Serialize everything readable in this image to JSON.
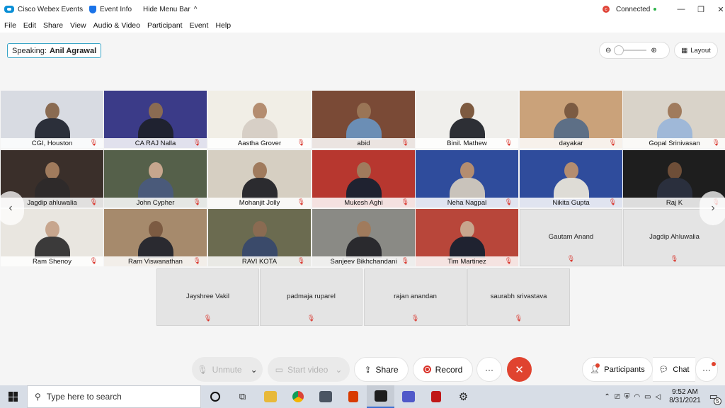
{
  "titlebar": {
    "app_name": "Cisco Webex Events",
    "event_info": "Event Info",
    "hide_menu": "Hide Menu Bar",
    "status": "Connected"
  },
  "menu": [
    "File",
    "Edit",
    "Share",
    "View",
    "Audio & Video",
    "Participant",
    "Event",
    "Help"
  ],
  "speaking": {
    "label": "Speaking:",
    "name": "Anil Agrawal"
  },
  "layout_label": "Layout",
  "participants": [
    {
      "name": "CGI, Houston",
      "bg": "#d8dbe2",
      "skin": "#8a6b52",
      "shirt": "#2b2f3a"
    },
    {
      "name": "CA RAJ Nalla",
      "bg": "#3b3b88",
      "skin": "#8a6b52",
      "shirt": "#1f2230"
    },
    {
      "name": "Aastha Grover",
      "bg": "#f1eee6",
      "skin": "#b48d70",
      "shirt": "#d7cfc6"
    },
    {
      "name": "abid",
      "bg": "#7a4a36",
      "skin": "#9a7556",
      "shirt": "#6b8eb5"
    },
    {
      "name": "Binil. Mathew",
      "bg": "#f0efec",
      "skin": "#7d5a40",
      "shirt": "#2d2f35"
    },
    {
      "name": "dayakar",
      "bg": "#caa27a",
      "skin": "#7c5b42",
      "shirt": "#5d6f86"
    },
    {
      "name": "Gopal Srinivasan",
      "bg": "#d9d3c9",
      "skin": "#a07b5d",
      "shirt": "#9fb8d8"
    },
    {
      "name": "Jagdip ahluwalia",
      "bg": "#3a2f2a",
      "skin": "#a07b5d",
      "shirt": "#2e2a2a"
    },
    {
      "name": "John Cypher",
      "bg": "#55604a",
      "skin": "#c7a68e",
      "shirt": "#4a5a7a"
    },
    {
      "name": "Mohanjit Jolly",
      "bg": "#d6cfc2",
      "skin": "#a07b5d",
      "shirt": "#2b2b2f"
    },
    {
      "name": "Mukesh Aghi",
      "bg": "#b7372f",
      "skin": "#a07b5d",
      "shirt": "#1f2230"
    },
    {
      "name": "Neha Nagpal",
      "bg": "#2f4c9c",
      "skin": "#b48d70",
      "shirt": "#c9c3bb"
    },
    {
      "name": "Nikita Gupta",
      "bg": "#2f4c9c",
      "skin": "#b48d70",
      "shirt": "#dedcd6"
    },
    {
      "name": "Raj K",
      "bg": "#1e1e1e",
      "skin": "#6e4e38",
      "shirt": "#2a2f3d"
    },
    {
      "name": "Ram Shenoy",
      "bg": "#e9e6e0",
      "skin": "#c7a68e",
      "shirt": "#3b3a3a"
    },
    {
      "name": "Ram Viswanathan",
      "bg": "#a68a6c",
      "skin": "#7c5b42",
      "shirt": "#2a2a30"
    },
    {
      "name": "RAVI KOTA",
      "bg": "#6b6b50",
      "skin": "#8a6b52",
      "shirt": "#3a4a6a"
    },
    {
      "name": "Sanjeev Bikhchandani",
      "bg": "#8a8a85",
      "skin": "#a07b5d",
      "shirt": "#2a2a2e"
    },
    {
      "name": "Tim Martinez",
      "bg": "#b8463a",
      "skin": "#c7a68e",
      "shirt": "#1f2230"
    }
  ],
  "no_video_participants": [
    "Gautam Anand",
    "Jagdip Ahluwalia",
    "Jayshree Vakil",
    "padmaja ruparel",
    "rajan anandan",
    "saurabh srivastava"
  ],
  "controls": {
    "unmute": "Unmute",
    "start_video": "Start video",
    "share": "Share",
    "record": "Record",
    "more": "···",
    "end": "✕",
    "participants": "Participants",
    "chat": "Chat"
  },
  "taskbar": {
    "search_placeholder": "Type here to search",
    "time": "9:52 AM",
    "date": "8/31/2021",
    "notifications": "5"
  },
  "colors": {
    "accent": "#0a8fd6",
    "danger": "#e0432f"
  }
}
